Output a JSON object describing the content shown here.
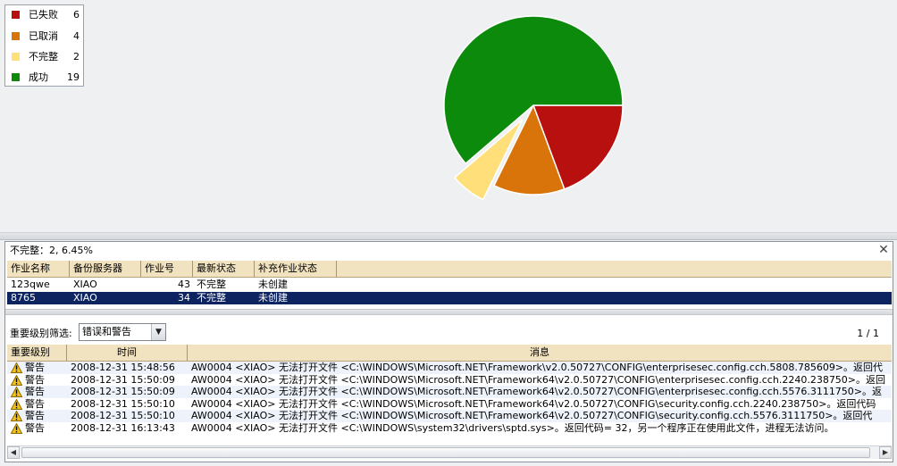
{
  "legend": [
    {
      "label": "已失败",
      "count": "6",
      "color": "#b80f0f"
    },
    {
      "label": "已取消",
      "count": "4",
      "color": "#d8740a"
    },
    {
      "label": "不完整",
      "count": "2",
      "color": "#ffdf7a"
    },
    {
      "label": "成功",
      "count": "19",
      "color": "#0b8a0b"
    }
  ],
  "chart_data": {
    "type": "pie",
    "categories": [
      "已失败",
      "已取消",
      "不完整",
      "成功"
    ],
    "values": [
      6,
      4,
      2,
      19
    ],
    "colors": [
      "#b80f0f",
      "#d8740a",
      "#ffdf7a",
      "#0b8a0b"
    ],
    "exploded": "不完整",
    "legend_position": "top-left"
  },
  "panel": {
    "title": "不完整：2, 6.45%",
    "close_icon": "close-icon"
  },
  "jobs": {
    "columns": [
      "作业名称",
      "备份服务器",
      "作业号",
      "最新状态",
      "补充作业状态"
    ],
    "rows": [
      {
        "name": "123qwe",
        "server": "XIAO",
        "id": "43",
        "status": "不完整",
        "extra": "未创建",
        "selected": false
      },
      {
        "name": "8765",
        "server": "XIAO",
        "id": "34",
        "status": "不完整",
        "extra": "未创建",
        "selected": true
      }
    ]
  },
  "filter": {
    "label": "重要级别筛选:",
    "value": "错误和警告",
    "page": "1 / 1"
  },
  "log": {
    "columns": [
      "重要级别",
      "时间",
      "消息"
    ],
    "rows": [
      {
        "level": "警告",
        "time": "2008-12-31 15:48:56",
        "message": "AW0004 <XIAO> 无法打开文件 <C:\\WINDOWS\\Microsoft.NET\\Framework\\v2.0.50727\\CONFIG\\enterprisesec.config.cch.5808.785609>。返回代"
      },
      {
        "level": "警告",
        "time": "2008-12-31 15:50:09",
        "message": "AW0004 <XIAO> 无法打开文件 <C:\\WINDOWS\\Microsoft.NET\\Framework64\\v2.0.50727\\CONFIG\\enterprisesec.config.cch.2240.238750>。返回"
      },
      {
        "level": "警告",
        "time": "2008-12-31 15:50:09",
        "message": "AW0004 <XIAO> 无法打开文件 <C:\\WINDOWS\\Microsoft.NET\\Framework64\\v2.0.50727\\CONFIG\\enterprisesec.config.cch.5576.3111750>。返"
      },
      {
        "level": "警告",
        "time": "2008-12-31 15:50:10",
        "message": "AW0004 <XIAO> 无法打开文件 <C:\\WINDOWS\\Microsoft.NET\\Framework64\\v2.0.50727\\CONFIG\\security.config.cch.2240.238750>。返回代码"
      },
      {
        "level": "警告",
        "time": "2008-12-31 15:50:10",
        "message": "AW0004 <XIAO> 无法打开文件 <C:\\WINDOWS\\Microsoft.NET\\Framework64\\v2.0.50727\\CONFIG\\security.config.cch.5576.3111750>。返回代"
      },
      {
        "level": "警告",
        "time": "2008-12-31 16:13:43",
        "message": "AW0004 <XIAO> 无法打开文件 <C:\\WINDOWS\\system32\\drivers\\sptd.sys>。返回代码= 32，另一个程序正在使用此文件，进程无法访问。"
      }
    ]
  }
}
